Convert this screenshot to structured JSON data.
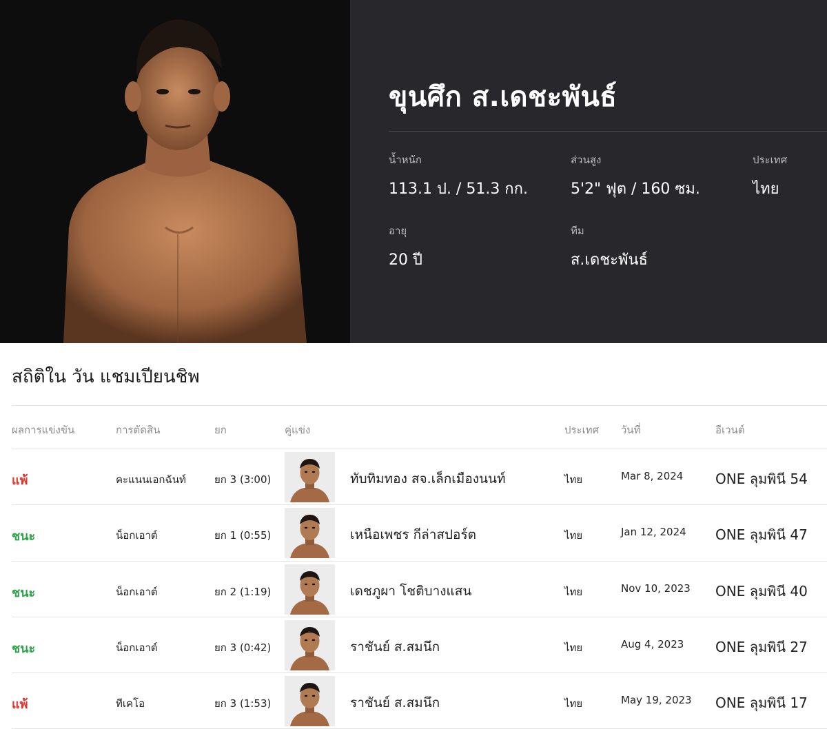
{
  "fighter": {
    "name": "ขุนศึก ส.เดชะพันธ์",
    "stats": {
      "weight_label": "น้ำหนัก",
      "weight_value": "113.1 ป. / 51.3 กก.",
      "height_label": "ส่วนสูง",
      "height_value": "5'2\" ฟุต / 160 ซม.",
      "country_label": "ประเทศ",
      "country_value": "ไทย",
      "age_label": "อายุ",
      "age_value": "20 ปี",
      "team_label": "ทีม",
      "team_value": "ส.เดชะพันธ์"
    }
  },
  "record": {
    "title": "สถิติใน วัน แชมเปียนชิพ",
    "headers": {
      "result": "ผลการแข่งขัน",
      "method": "การตัดสิน",
      "round": "ยก",
      "opponent": "คู่แข่ง",
      "country": "ประเทศ",
      "date": "วันที่",
      "event": "อีเวนต์"
    },
    "rows": [
      {
        "result": "แพ้",
        "outcome": "loss",
        "method": "คะแนนเอกฉันท์",
        "round": "ยก 3 (3:00)",
        "opponent": "ทับทิมทอง สจ.เล็กเมืองนนท์",
        "country": "ไทย",
        "date": "Mar 8, 2024",
        "event": "ONE ลุมพินี 54"
      },
      {
        "result": "ชนะ",
        "outcome": "win",
        "method": "น็อกเอาต์",
        "round": "ยก 1 (0:55)",
        "opponent": "เหนือเพชร กีล่าสปอร์ต",
        "country": "ไทย",
        "date": "Jan 12, 2024",
        "event": "ONE ลุมพินี 47"
      },
      {
        "result": "ชนะ",
        "outcome": "win",
        "method": "น็อกเอาต์",
        "round": "ยก 2 (1:19)",
        "opponent": "เดชภูผา โชติบางแสน",
        "country": "ไทย",
        "date": "Nov 10, 2023",
        "event": "ONE ลุมพินี 40"
      },
      {
        "result": "ชนะ",
        "outcome": "win",
        "method": "น็อกเอาต์",
        "round": "ยก 3 (0:42)",
        "opponent": "ราชันย์ ส.สมนึก",
        "country": "ไทย",
        "date": "Aug 4, 2023",
        "event": "ONE ลุมพินี 27"
      },
      {
        "result": "แพ้",
        "outcome": "loss",
        "method": "ทีเคโอ",
        "round": "ยก 3 (1:53)",
        "opponent": "ราชันย์ ส.สมนึก",
        "country": "ไทย",
        "date": "May 19, 2023",
        "event": "ONE ลุมพินี 17"
      }
    ]
  },
  "colors": {
    "win": "#2fa44b",
    "loss": "#e0382e",
    "hero_bg": "#28282c",
    "photo_bg": "#0d0d0d"
  }
}
